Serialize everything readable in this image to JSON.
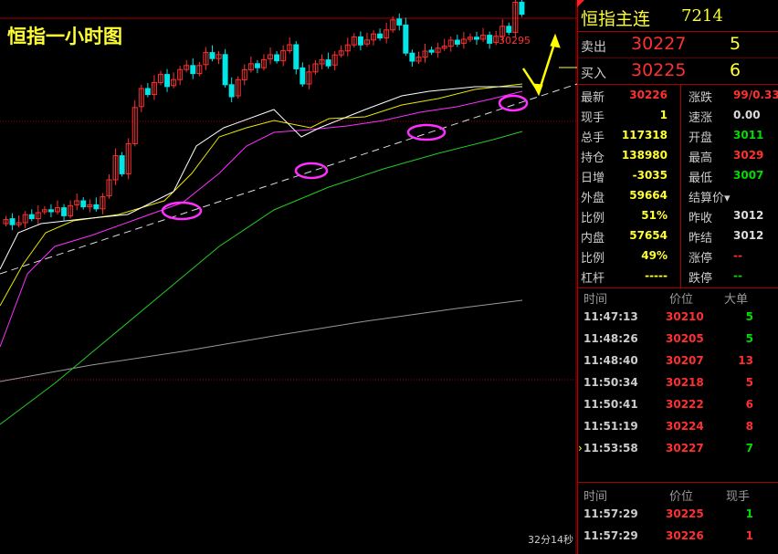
{
  "chart": {
    "title": "恒指一小时图",
    "high_marker": "30295",
    "timer": "32分14秒",
    "colors": {
      "up": "#ff3030",
      "down": "#00e5e5",
      "ma_fast": "#ffffff",
      "ma_mid": "#e8e800",
      "ma_slow": "#ff30ff",
      "ma_long": "#22cc22",
      "ma_longest": "#999999",
      "annotation_circle": "#ff30ff",
      "annotation_arrow": "#ffff00"
    }
  },
  "panel": {
    "name": "恒指主连",
    "code": "7214",
    "sell": {
      "label": "卖出",
      "price": "30227",
      "volume": "5"
    },
    "buy": {
      "label": "买入",
      "price": "30225",
      "volume": "6"
    },
    "stats": [
      {
        "l1": "最新",
        "v1": "30226",
        "c1": "red",
        "l2": "涨跌",
        "v2": "99/0.33",
        "c2": "red"
      },
      {
        "l1": "现手",
        "v1": "1",
        "c1": "yellow",
        "l2": "速涨",
        "v2": "0.00",
        "c2": "white"
      },
      {
        "l1": "总手",
        "v1": "117318",
        "c1": "yellow",
        "l2": "开盘",
        "v2": "3011",
        "c2": "green"
      },
      {
        "l1": "持仓",
        "v1": "138980",
        "c1": "yellow",
        "l2": "最高",
        "v2": "3029",
        "c2": "red"
      },
      {
        "l1": "日增",
        "v1": "-3035",
        "c1": "yellow",
        "l2": "最低",
        "v2": "3007",
        "c2": "green"
      },
      {
        "l1": "外盘",
        "v1": "59664",
        "c1": "yellow",
        "l2": "结算价▾",
        "v2": "",
        "c2": "white"
      },
      {
        "l1": "比例",
        "v1": "51%",
        "c1": "yellow",
        "l2": "昨收",
        "v2": "3012",
        "c2": "white"
      },
      {
        "l1": "内盘",
        "v1": "57654",
        "c1": "yellow",
        "l2": "昨结",
        "v2": "3012",
        "c2": "white"
      },
      {
        "l1": "比例",
        "v1": "49%",
        "c1": "yellow",
        "l2": "涨停",
        "v2": "--",
        "c2": "red"
      },
      {
        "l1": "杠杆",
        "v1": "-----",
        "c1": "yellow",
        "l2": "跌停",
        "v2": "--",
        "c2": "green"
      }
    ],
    "ticks_big": {
      "headers": [
        "时间",
        "价位",
        "大单"
      ],
      "rows": [
        {
          "time": "11:47:13",
          "price": "30210",
          "qty": "5",
          "qc": "green"
        },
        {
          "time": "11:48:26",
          "price": "30205",
          "qty": "5",
          "qc": "green"
        },
        {
          "time": "11:48:40",
          "price": "30207",
          "qty": "13",
          "qc": "red"
        },
        {
          "time": "11:50:34",
          "price": "30218",
          "qty": "5",
          "qc": "red"
        },
        {
          "time": "11:50:41",
          "price": "30222",
          "qty": "6",
          "qc": "red"
        },
        {
          "time": "11:51:19",
          "price": "30224",
          "qty": "8",
          "qc": "red"
        },
        {
          "time": "11:53:58",
          "price": "30227",
          "qty": "7",
          "qc": "green"
        }
      ]
    },
    "ticks_live": {
      "headers": [
        "时间",
        "价位",
        "现手"
      ],
      "rows": [
        {
          "time": "11:57:29",
          "price": "30225",
          "qty": "1",
          "qc": "green"
        },
        {
          "time": "11:57:29",
          "price": "30226",
          "qty": "1",
          "qc": "red"
        }
      ]
    }
  }
}
